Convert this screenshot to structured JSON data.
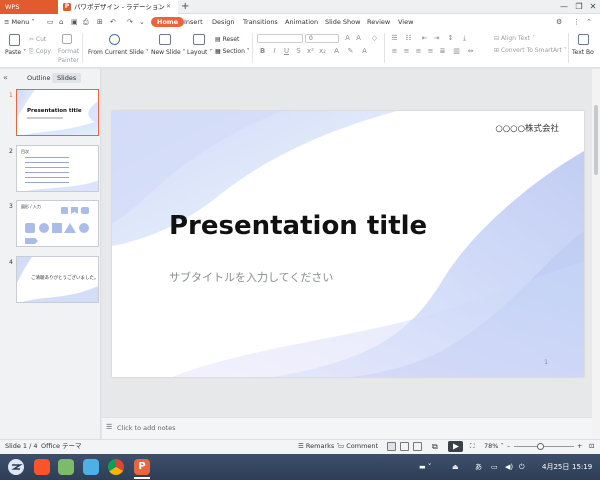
{
  "titlebar": {
    "app_tab": "WPS Presentation",
    "doc_tab": "パワポデザイン - ラデーション",
    "doc_icon": "P",
    "new_tab": "+",
    "win_controls": [
      "—",
      "❐",
      "✕"
    ]
  },
  "menubar": {
    "menu_label": "Menu",
    "tabs": [
      "Home",
      "Insert",
      "Design",
      "Transitions",
      "Animation",
      "Slide Show",
      "Review",
      "View"
    ],
    "active_tab": "Home"
  },
  "ribbon": {
    "paste": "Paste",
    "cut": "Cut",
    "copy": "Copy",
    "format_painter_1": "Format",
    "format_painter_2": "Painter",
    "from_current_slide": "From Current Slide",
    "new_slide": "New Slide",
    "layout": "Layout",
    "reset": "Reset",
    "section": "Section",
    "font_size": "0",
    "align_text": "Align Text",
    "convert_smartart": "Convert To SmartArt",
    "text_box": "Text Bo"
  },
  "left_panel": {
    "tab_outline": "Outline",
    "tab_slides": "Slides",
    "slides": [
      {
        "number": "1",
        "title": "Presentation title"
      },
      {
        "number": "2",
        "title": "目次"
      },
      {
        "number": "3",
        "title": "図形 / 入力"
      },
      {
        "number": "4",
        "title": "ご清聴ありがとうございました。"
      }
    ]
  },
  "slide": {
    "company": "○○○○株式会社",
    "title": "Presentation title",
    "subtitle": "サブタイトルを入力してください",
    "page_number": "1"
  },
  "notes": {
    "placeholder": "Click to add notes"
  },
  "statusbar": {
    "slide_info": "Slide 1 / 4",
    "theme": "Office テーマ",
    "remarks": "Remarks",
    "comment": "Comment",
    "zoom": "78%",
    "zoom_minus": "–",
    "zoom_plus": "+"
  },
  "taskbar": {
    "ime": "あ",
    "date": "4月25日",
    "time": "15:19"
  },
  "colors": {
    "accent": "#e8663d",
    "slide_gradient_a": "#b9c7f4",
    "slide_gradient_b": "#d7e7fb"
  }
}
